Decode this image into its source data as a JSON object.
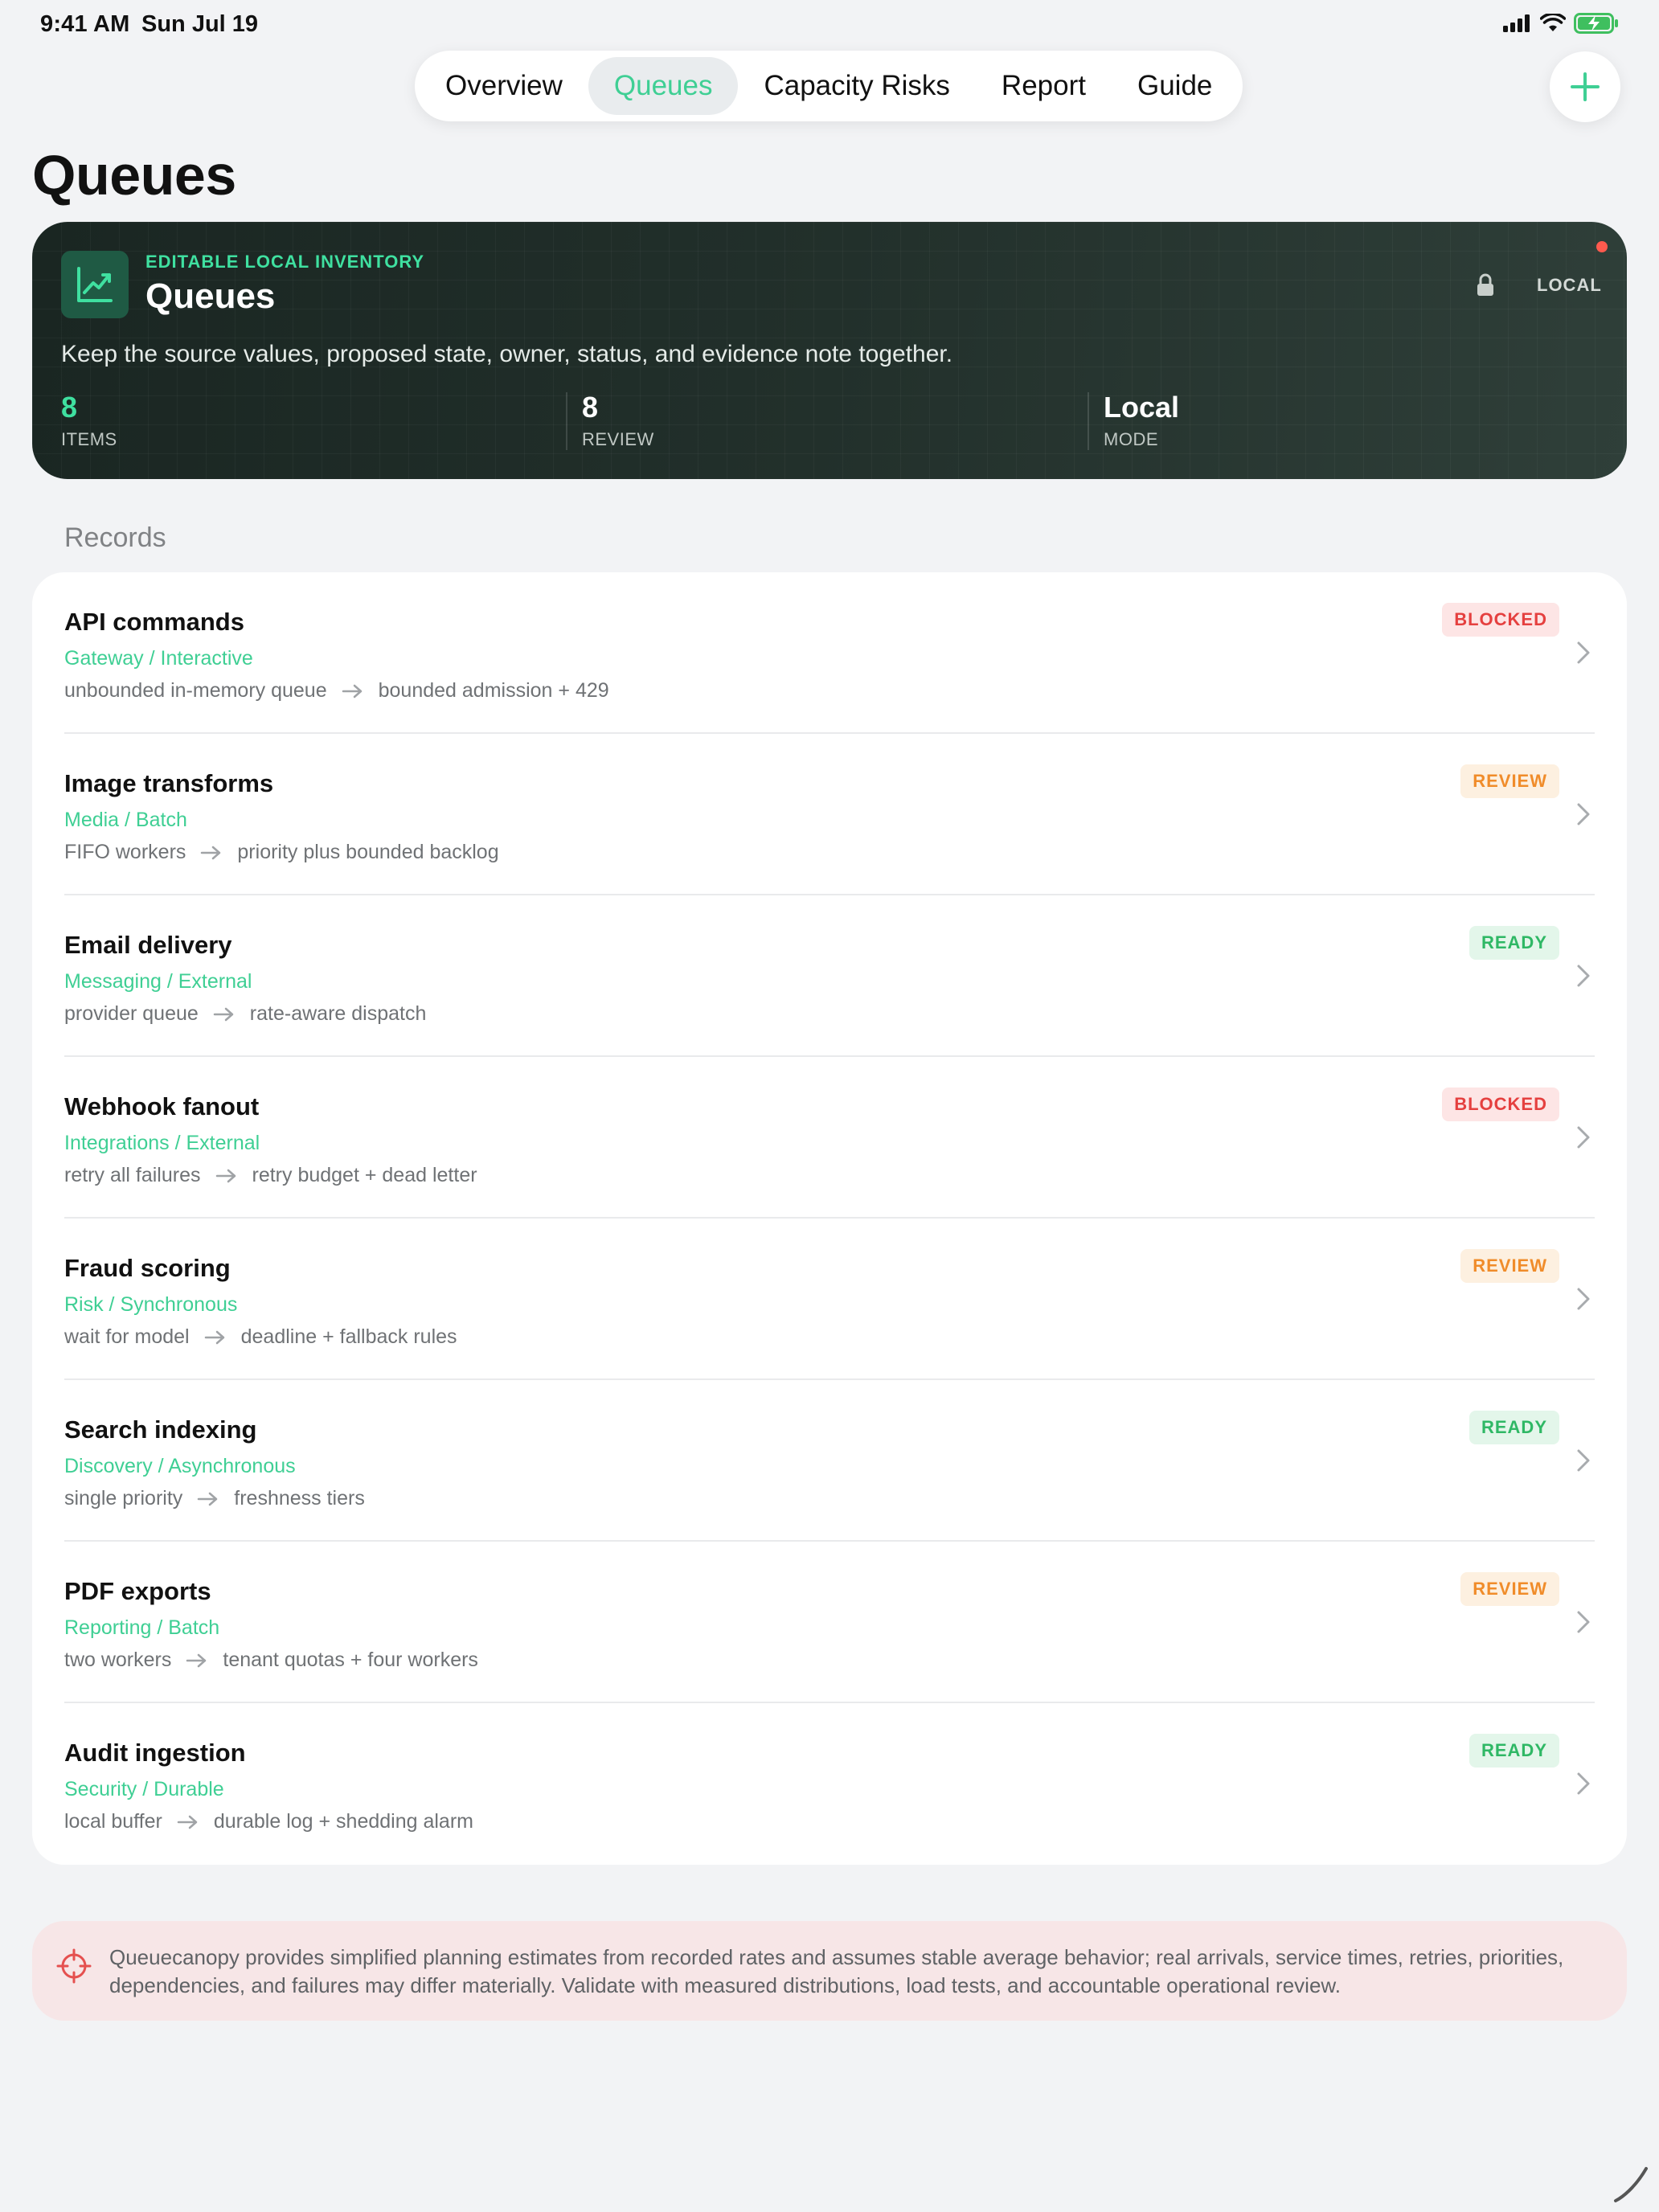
{
  "status_bar": {
    "time": "9:41 AM",
    "date": "Sun Jul 19"
  },
  "tabs": [
    {
      "label": "Overview",
      "active": false
    },
    {
      "label": "Queues",
      "active": true
    },
    {
      "label": "Capacity Risks",
      "active": false
    },
    {
      "label": "Report",
      "active": false
    },
    {
      "label": "Guide",
      "active": false
    }
  ],
  "page": {
    "title": "Queues"
  },
  "hero": {
    "eyebrow": "EDITABLE LOCAL INVENTORY",
    "title": "Queues",
    "mode_badge": "LOCAL",
    "description": "Keep the source values, proposed state, owner, status, and evidence note together.",
    "stats": [
      {
        "value": "8",
        "label": "ITEMS"
      },
      {
        "value": "8",
        "label": "REVIEW"
      },
      {
        "value": "Local",
        "label": "MODE"
      }
    ]
  },
  "records_label": "Records",
  "records": [
    {
      "title": "API commands",
      "subtitle": "Gateway / Interactive",
      "from": "unbounded in-memory queue",
      "to": "bounded admission + 429",
      "status": "BLOCKED"
    },
    {
      "title": "Image transforms",
      "subtitle": "Media / Batch",
      "from": "FIFO workers",
      "to": "priority plus bounded backlog",
      "status": "REVIEW"
    },
    {
      "title": "Email delivery",
      "subtitle": "Messaging / External",
      "from": "provider queue",
      "to": "rate-aware dispatch",
      "status": "READY"
    },
    {
      "title": "Webhook fanout",
      "subtitle": "Integrations / External",
      "from": "retry all failures",
      "to": "retry budget + dead letter",
      "status": "BLOCKED"
    },
    {
      "title": "Fraud scoring",
      "subtitle": "Risk / Synchronous",
      "from": "wait for model",
      "to": "deadline + fallback rules",
      "status": "REVIEW"
    },
    {
      "title": "Search indexing",
      "subtitle": "Discovery / Asynchronous",
      "from": "single priority",
      "to": "freshness tiers",
      "status": "READY"
    },
    {
      "title": "PDF exports",
      "subtitle": "Reporting / Batch",
      "from": "two workers",
      "to": "tenant quotas + four workers",
      "status": "REVIEW"
    },
    {
      "title": "Audit ingestion",
      "subtitle": "Security / Durable",
      "from": "local buffer",
      "to": "durable log + shedding alarm",
      "status": "READY"
    }
  ],
  "disclaimer": "Queuecanopy provides simplified planning estimates from recorded rates and assumes stable average behavior; real arrivals, service times, retries, priorities, dependencies, and failures may differ materially. Validate with measured distributions, load tests, and accountable operational review.",
  "colors": {
    "accent": "#3fcf94",
    "blocked": "#e5403f",
    "review": "#f08c2a",
    "ready": "#2fb865"
  }
}
